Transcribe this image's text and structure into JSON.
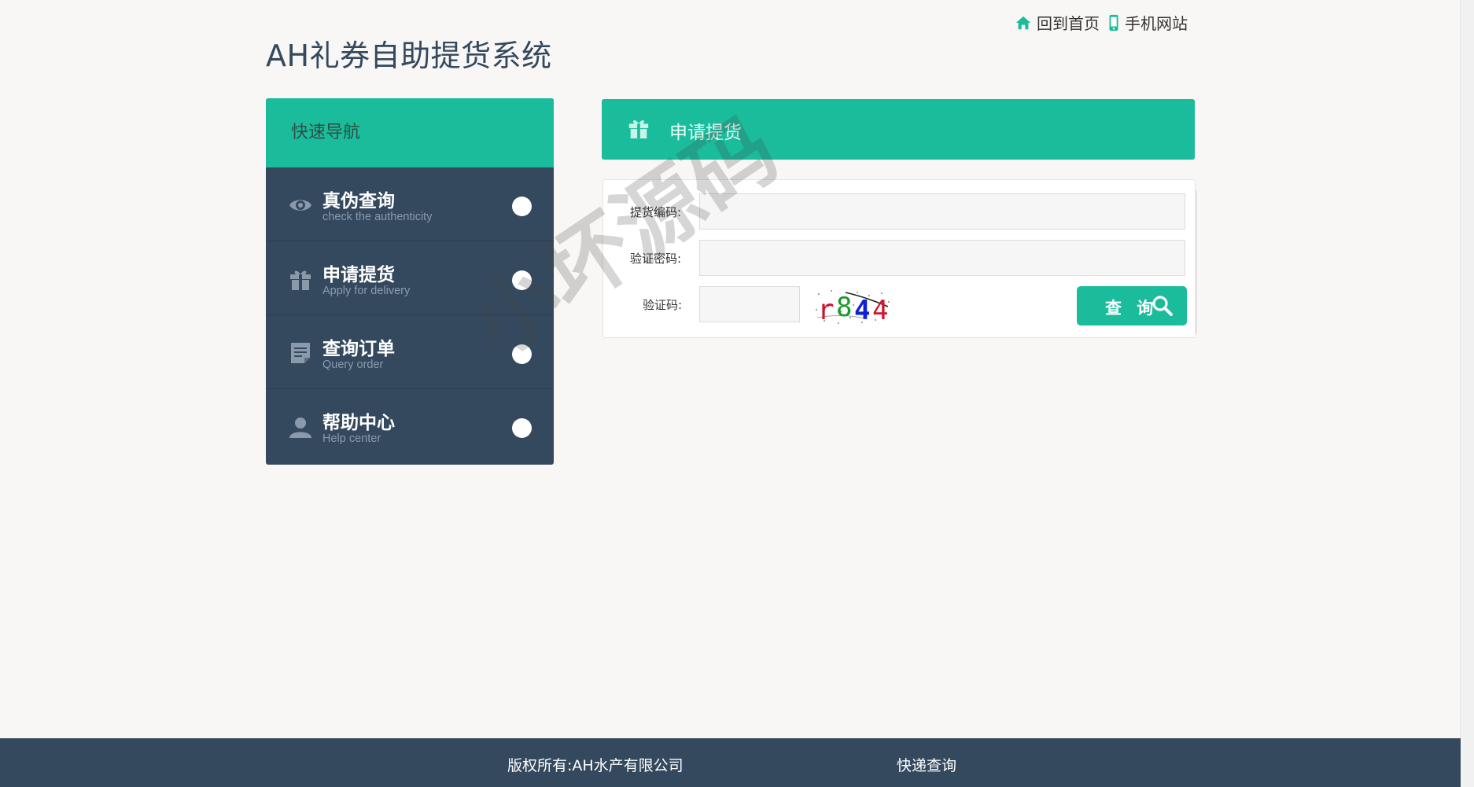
{
  "top_links": {
    "home": "回到首页",
    "mobile": "手机网站"
  },
  "site_title": "AH礼券自助提货系统",
  "nav": {
    "header": "快速导航",
    "items": [
      {
        "title": "真伪查询",
        "subtitle": "check the authenticity",
        "icon": "eye-icon"
      },
      {
        "title": "申请提货",
        "subtitle": "Apply for delivery",
        "icon": "gift-icon"
      },
      {
        "title": "查询订单",
        "subtitle": "Query order",
        "icon": "document-icon"
      },
      {
        "title": "帮助中心",
        "subtitle": "Help center",
        "icon": "user-icon"
      }
    ]
  },
  "panel": {
    "title": "申请提货",
    "icon": "gift-icon"
  },
  "form": {
    "code_label": "提货编码:",
    "code_value": "",
    "password_label": "验证密码:",
    "password_value": "",
    "captcha_label": "验证码:",
    "captcha_value": "",
    "captcha_text": "r844",
    "query_button": "查 询"
  },
  "watermark": "小坏源码",
  "footer": {
    "copyright": "版权所有:AH水产有限公司",
    "express_link": "快递查询"
  },
  "colors": {
    "accent": "#1abc9c",
    "navy": "#34495e",
    "background": "#f8f7f5"
  }
}
